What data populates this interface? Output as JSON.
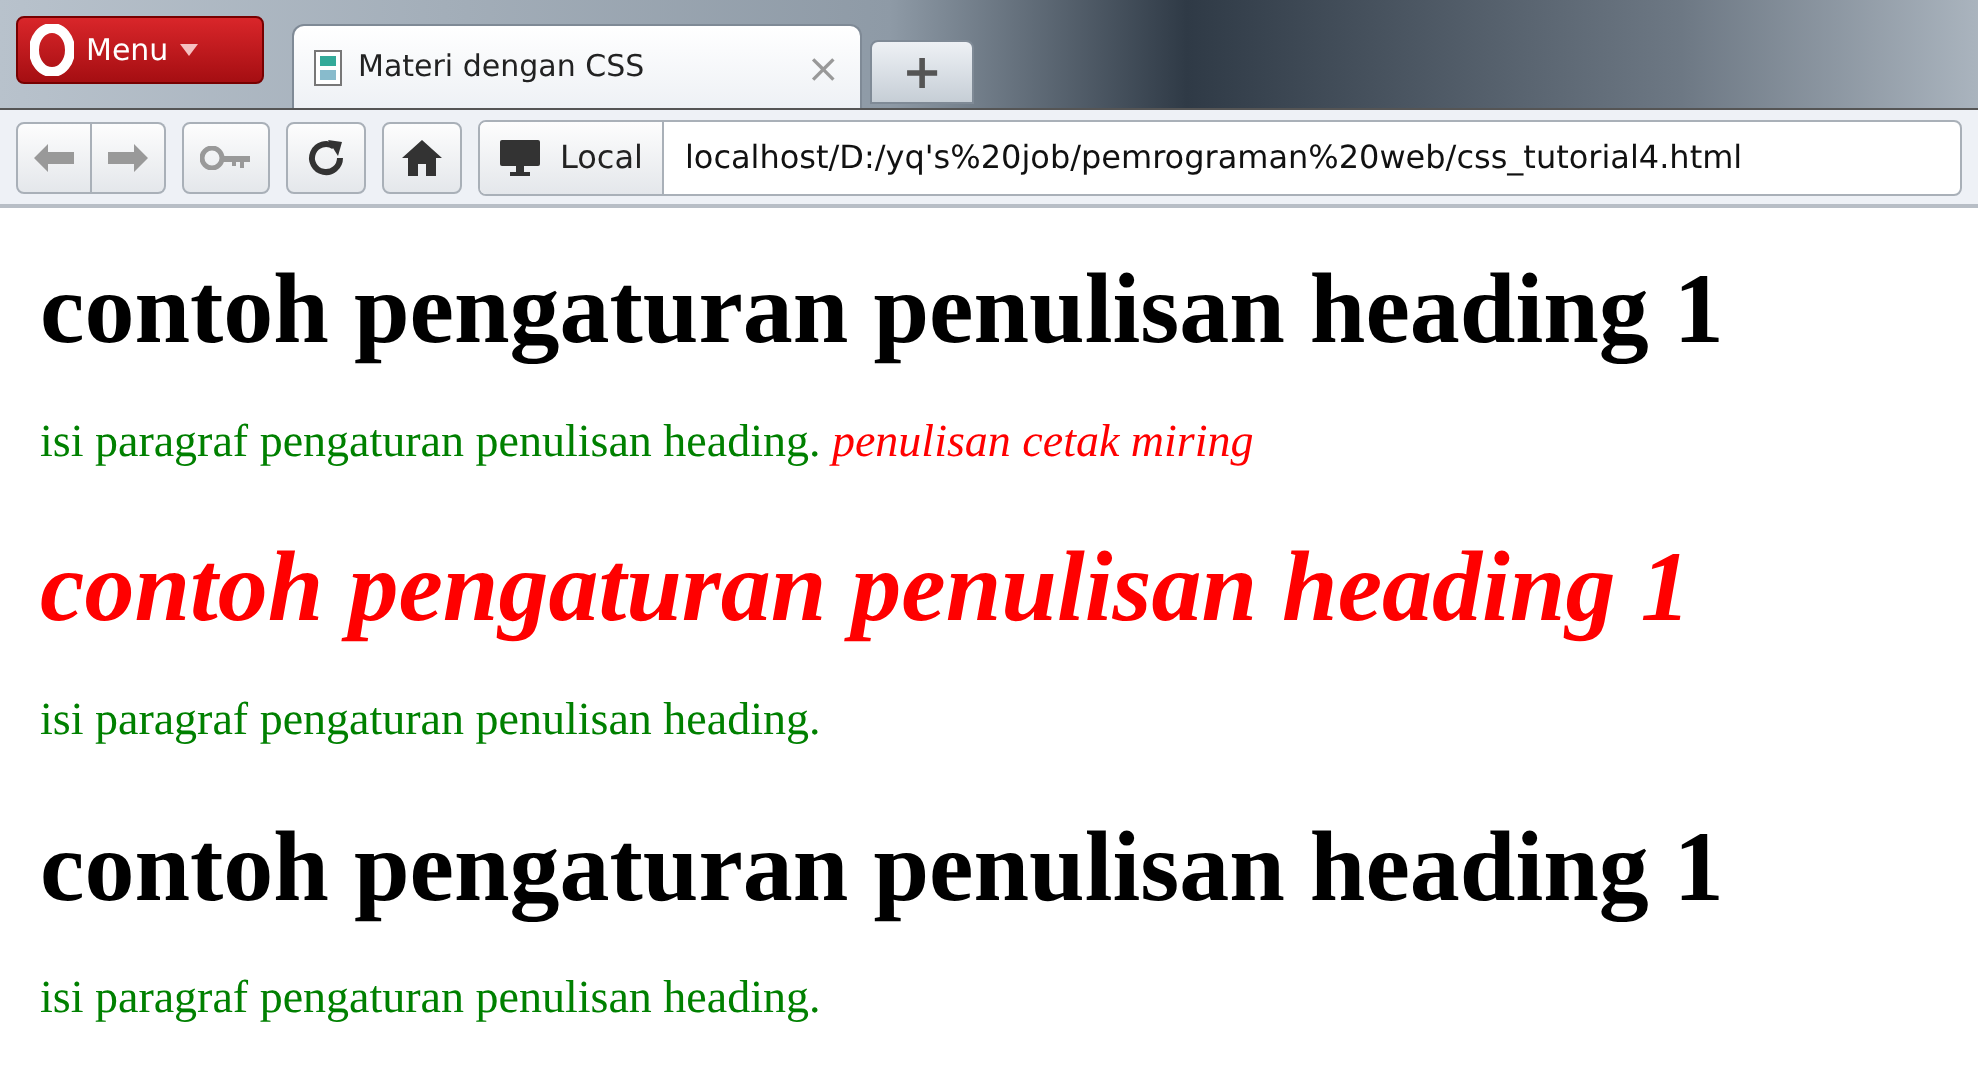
{
  "browser": {
    "menu_label": "Menu",
    "tabs": [
      {
        "title": "Materi dengan CSS",
        "selected": true
      }
    ],
    "close_glyph": "×",
    "new_tab_glyph": "+",
    "security_label": "Local",
    "address": "localhost/D:/yq's%20job/pemrograman%20web/css_tutorial4.html"
  },
  "content": [
    {
      "kind": "heading",
      "text": "contoh pengaturan penulisan heading 1",
      "italic": false,
      "color": "#000000"
    },
    {
      "kind": "paragraph",
      "segments": [
        {
          "text": "isi paragraf pengaturan penulisan heading.",
          "italic": false,
          "color": "#008000"
        },
        {
          "text": "penulisan cetak miring",
          "italic": true,
          "color": "#ff0000"
        }
      ]
    },
    {
      "kind": "heading",
      "text": "contoh pengaturan penulisan heading 1",
      "italic": true,
      "color": "#ff0000"
    },
    {
      "kind": "paragraph",
      "segments": [
        {
          "text": "isi paragraf pengaturan penulisan heading.",
          "italic": false,
          "color": "#008000"
        }
      ]
    },
    {
      "kind": "heading",
      "text": "contoh pengaturan penulisan heading 1",
      "italic": false,
      "color": "#000000"
    },
    {
      "kind": "paragraph",
      "segments": [
        {
          "text": "isi paragraf pengaturan penulisan heading.",
          "italic": false,
          "color": "#008000"
        }
      ]
    }
  ]
}
